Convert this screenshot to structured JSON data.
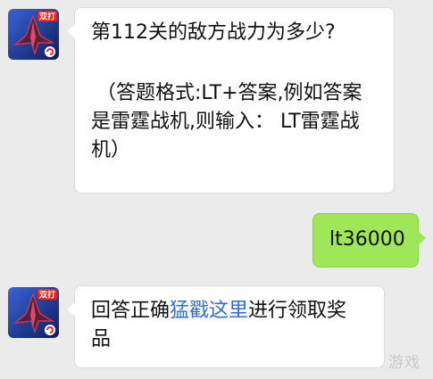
{
  "messages": [
    {
      "sender": "bot",
      "lines": [
        "第112关的敌方战力为多少?",
        "",
        "",
        "（答题格式:LT+答案,例如答案",
        "是雷霆战机,则输入： LT雷霆战",
        "机）"
      ]
    },
    {
      "sender": "user",
      "text": "lt36000"
    },
    {
      "sender": "bot",
      "line1_plain": "回答正确",
      "line1_link": "猛戳这里",
      "line1_after": "进行领取奖",
      "line2": "品"
    }
  ],
  "avatar": {
    "badge_text": "双打",
    "badge_color": "#e8241c",
    "bg_color": "#1a2d7a"
  },
  "watermark": "游戏",
  "colors": {
    "link": "#2b6fd6",
    "outgoing_bubble": "#9fe658",
    "background": "#ebebeb"
  }
}
